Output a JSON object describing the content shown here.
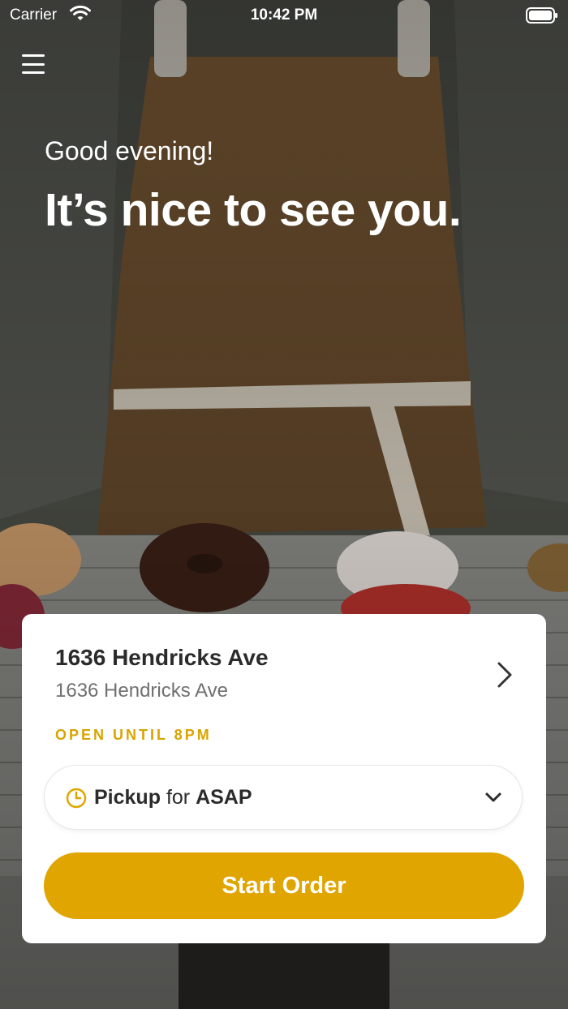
{
  "status_bar": {
    "carrier": "Carrier",
    "time": "10:42 PM"
  },
  "hero": {
    "greeting": "Good evening!",
    "headline": "It’s nice to see you."
  },
  "store": {
    "name": "1636 Hendricks Ave",
    "address": "1636 Hendricks Ave",
    "hours": "OPEN UNTIL 8PM"
  },
  "pickup": {
    "mode": "Pickup",
    "connector": "for",
    "time": "ASAP"
  },
  "actions": {
    "start_order": "Start Order"
  },
  "colors": {
    "accent": "#e0a500",
    "hours_text": "#d9a300"
  },
  "icons": {
    "menu": "hamburger-menu-icon",
    "store_arrow": "chevron-right-icon",
    "clock": "clock-icon",
    "dropdown": "chevron-down-icon"
  }
}
